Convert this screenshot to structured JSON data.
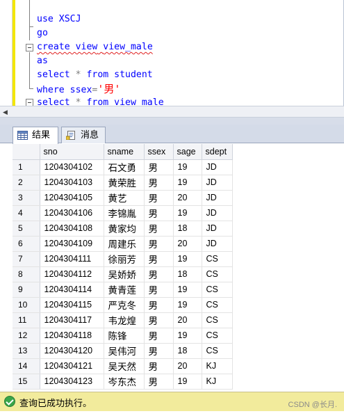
{
  "editor": {
    "lines": [
      {
        "text": "use XSCJ"
      },
      {
        "text": "go"
      },
      {
        "text": "create view view_male"
      },
      {
        "text": "as"
      },
      {
        "text": "select * from student"
      },
      {
        "text": "where ssex='男'"
      },
      {
        "text": "select * from view_male"
      }
    ],
    "tokens": {
      "l0": "use XSCJ",
      "l1": "go",
      "l2_kw": "create view",
      "l2_sp": " ",
      "l2_name": "view_male",
      "l3": "as",
      "l4_a": "select ",
      "l4_star": "*",
      "l4_b": " from student",
      "l5_a": "where ssex",
      "l5_eq": "=",
      "l5_str": "'男'",
      "l6_a": "select ",
      "l6_star": "*",
      "l6_b": " from ",
      "l6_name": "view_male"
    }
  },
  "tabs": {
    "results": "结果",
    "messages": "消息"
  },
  "grid": {
    "columns": [
      "sno",
      "sname",
      "ssex",
      "sage",
      "sdept"
    ],
    "rows": [
      [
        "1",
        "1204304102",
        "石文勇",
        "男",
        "19",
        "JD"
      ],
      [
        "2",
        "1204304103",
        "黄荣胜",
        "男",
        "19",
        "JD"
      ],
      [
        "3",
        "1204304105",
        "黄艺",
        "男",
        "20",
        "JD"
      ],
      [
        "4",
        "1204304106",
        "李锦胤",
        "男",
        "19",
        "JD"
      ],
      [
        "5",
        "1204304108",
        "黄家均",
        "男",
        "18",
        "JD"
      ],
      [
        "6",
        "1204304109",
        "周建乐",
        "男",
        "20",
        "JD"
      ],
      [
        "7",
        "1204304111",
        "徐丽芳",
        "男",
        "19",
        "CS"
      ],
      [
        "8",
        "1204304112",
        "吴娇娇",
        "男",
        "18",
        "CS"
      ],
      [
        "9",
        "1204304114",
        "黄青莲",
        "男",
        "19",
        "CS"
      ],
      [
        "10",
        "1204304115",
        "严克冬",
        "男",
        "19",
        "CS"
      ],
      [
        "11",
        "1204304117",
        "韦龙煌",
        "男",
        "20",
        "CS"
      ],
      [
        "12",
        "1204304118",
        "陈锋",
        "男",
        "19",
        "CS"
      ],
      [
        "13",
        "1204304120",
        "吴伟河",
        "男",
        "18",
        "CS"
      ],
      [
        "14",
        "1204304121",
        "吴天然",
        "男",
        "20",
        "KJ"
      ],
      [
        "15",
        "1204304123",
        "岑东杰",
        "男",
        "19",
        "KJ"
      ]
    ]
  },
  "status": {
    "message": "查询已成功执行。",
    "watermark": "CSDN @长月."
  },
  "colors": {
    "keyword": "#0000ff",
    "operator": "#808080",
    "string": "#ff0000",
    "status_bg": "#f2eb9c",
    "tab_strip": "#d4dbe8"
  }
}
